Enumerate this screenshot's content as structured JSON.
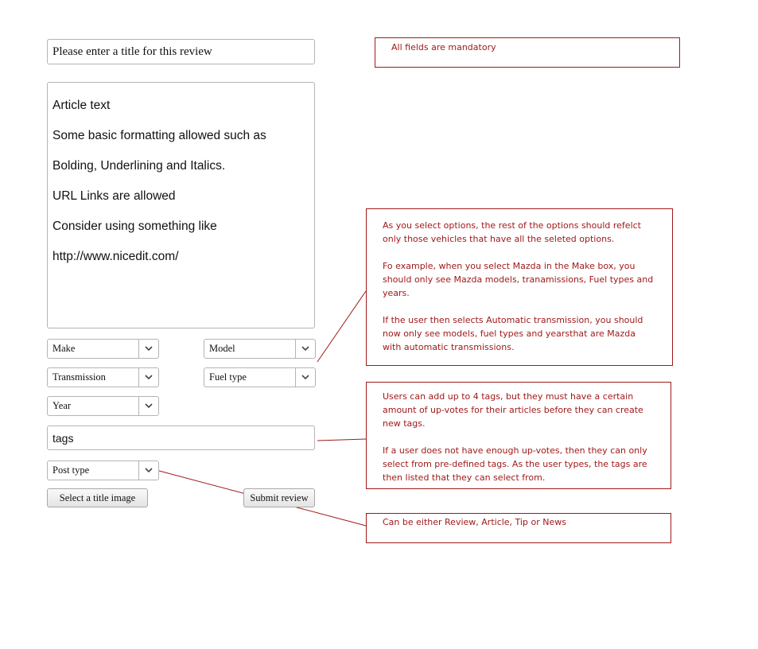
{
  "form": {
    "title_placeholder": "Please enter a title for this review",
    "article_lines": [
      "Article text",
      "Some basic formatting allowed such as",
      "Bolding, Underlining and Italics.",
      "URL Links are allowed",
      "Consider using something like",
      "http://www.nicedit.com/"
    ],
    "make_select": "Make",
    "model_select": "Model",
    "transmission_select": "Transmission",
    "fuel_select": "Fuel type",
    "year_select": "Year",
    "tags_placeholder": "tags",
    "post_type_select": "Post type",
    "title_image_button": "Select a title image",
    "submit_button": "Submit review"
  },
  "notes": {
    "mandatory": "All fields are mandatory",
    "options": [
      "As you select options, the rest of the options should refelct only those vehicles that have all the seleted options.",
      "Fo example, when you select Mazda in the Make box, you should only see Mazda models, tranamissions, Fuel types and years.",
      "If the user then selects Automatic transmission, you should now only see models, fuel types and yearsthat are Mazda with automatic transmissions."
    ],
    "tags": [
      "Users can add up to 4 tags, but they must have a certain amount of up-votes for their articles before they can create new tags.",
      "If a user does not have enough up-votes, then they can only select from pre-defined tags. As the user types, the tags are then listed that they can select from."
    ],
    "post_type": "Can be either Review, Article, Tip or News"
  },
  "colors": {
    "annotation": "#a01a1a",
    "field_border": "#b4b4b4"
  }
}
